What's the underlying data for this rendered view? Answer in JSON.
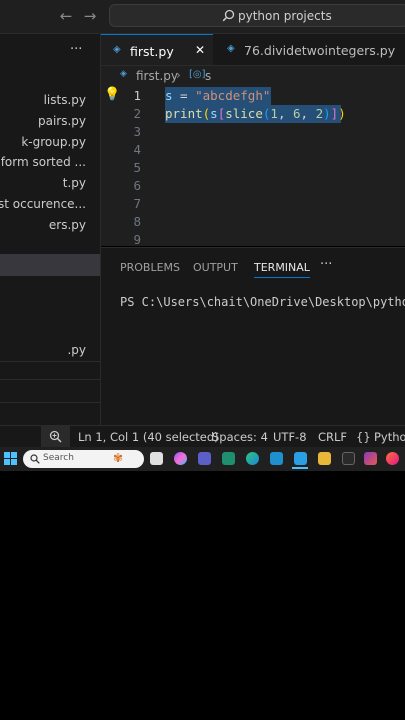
{
  "titlebar": {
    "search_text": "python projects"
  },
  "sidebar": {
    "more": "···",
    "items": [
      {
        "label": "lists.py"
      },
      {
        "label": "pairs.py"
      },
      {
        "label": "k-group.py"
      },
      {
        "label": "ates form sorted ..."
      },
      {
        "label": "t.py"
      },
      {
        "label": "of first occurence..."
      },
      {
        "label": "ers.py"
      }
    ],
    "item_bottom": ".py"
  },
  "tabs": [
    {
      "label": "first.py",
      "close": "✕"
    },
    {
      "label": "76.dividetwointegers.py"
    }
  ],
  "breadcrumb": {
    "file": "first.py",
    "symbol": "s"
  },
  "editor": {
    "line_numbers": [
      "1",
      "2",
      "3",
      "4",
      "5",
      "6",
      "7",
      "8",
      "9"
    ],
    "line1": {
      "var": "s",
      "op": " = ",
      "str": "\"abcdefgh\""
    },
    "line2": {
      "fn": "print",
      "p1": "(",
      "arg": "s",
      "b1": "[",
      "fn2": "slice",
      "p2": "(",
      "n1": "1",
      "c1": ", ",
      "n2": "6",
      "c2": ", ",
      "n3": "2",
      "p3": ")",
      "b2": "]",
      "p4": ")"
    }
  },
  "panel": {
    "tabs": [
      "PROBLEMS",
      "OUTPUT",
      "TERMINAL",
      "···"
    ],
    "terminal_line": "PS C:\\Users\\chait\\OneDrive\\Desktop\\python"
  },
  "statusbar": {
    "position": "Ln 1, Col 1 (40 selected)",
    "spaces": "Spaces: 4",
    "encoding": "UTF-8",
    "eol": "CRLF",
    "braces": "{}",
    "language": "Python"
  },
  "taskbar": {
    "search_placeholder": "Search"
  },
  "colors": {
    "accent": "#0078d4",
    "string": "#ce9178",
    "number": "#b5cea8",
    "function": "#dcdcaa",
    "selection": "#264f78"
  }
}
